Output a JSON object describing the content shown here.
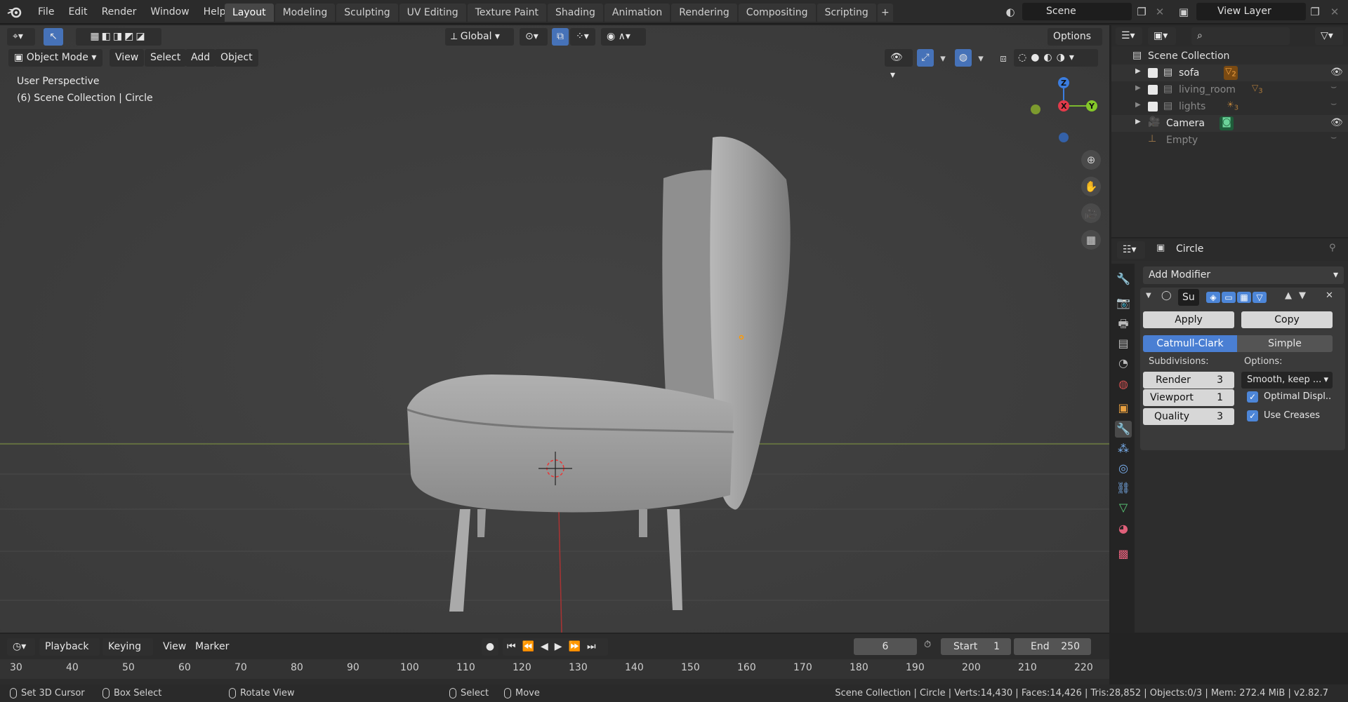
{
  "menu": [
    "File",
    "Edit",
    "Render",
    "Window",
    "Help"
  ],
  "workspaces": [
    "Layout",
    "Modeling",
    "Sculpting",
    "UV Editing",
    "Texture Paint",
    "Shading",
    "Animation",
    "Rendering",
    "Compositing",
    "Scripting"
  ],
  "scene": "Scene",
  "view_layer": "View Layer",
  "viewport": {
    "mode": "Object Mode",
    "menus": [
      "View",
      "Select",
      "Add",
      "Object"
    ],
    "orientation": "Global",
    "options": "Options",
    "perspective": "User Perspective",
    "collection_info": "(6) Scene Collection | Circle",
    "gizmo": {
      "x": "X",
      "y": "Y",
      "z": "Z"
    }
  },
  "outliner": {
    "root": "Scene Collection",
    "items": [
      {
        "name": "sofa",
        "badge": "2"
      },
      {
        "name": "living_room",
        "badge": "3"
      },
      {
        "name": "lights",
        "badge": "3"
      },
      {
        "name": "Camera",
        "badge": ""
      },
      {
        "name": "Empty",
        "badge": ""
      }
    ]
  },
  "properties": {
    "object": "Circle",
    "add_modifier": "Add Modifier",
    "modifier_name": "Su",
    "apply": "Apply",
    "copy": "Copy",
    "catmull": "Catmull-Clark",
    "simple": "Simple",
    "subdivisions_label": "Subdivisions:",
    "options_label": "Options:",
    "render_label": "Render",
    "render_val": "3",
    "viewport_label": "Viewport",
    "viewport_val": "1",
    "quality_label": "Quality",
    "quality_val": "3",
    "smooth": "Smooth, keep ...",
    "optimal": "Optimal Displ..",
    "creases": "Use Creases"
  },
  "timeline": {
    "menus": [
      "Playback",
      "Keying",
      "View",
      "Marker"
    ],
    "frame": "6",
    "start_label": "Start",
    "start": "1",
    "end_label": "End",
    "end": "250",
    "ticks": [
      "30",
      "40",
      "50",
      "60",
      "70",
      "80",
      "90",
      "100",
      "110",
      "120",
      "130",
      "140",
      "150",
      "160",
      "170",
      "180",
      "190",
      "200",
      "210",
      "220"
    ]
  },
  "status": {
    "set_cursor": "Set 3D Cursor",
    "box_select": "Box Select",
    "rotate": "Rotate View",
    "select": "Select",
    "move": "Move",
    "info": "Scene Collection | Circle | Verts:14,430 | Faces:14,426 | Tris:28,852 | Objects:0/3 | Mem: 272.4 MiB | v2.82.7"
  }
}
